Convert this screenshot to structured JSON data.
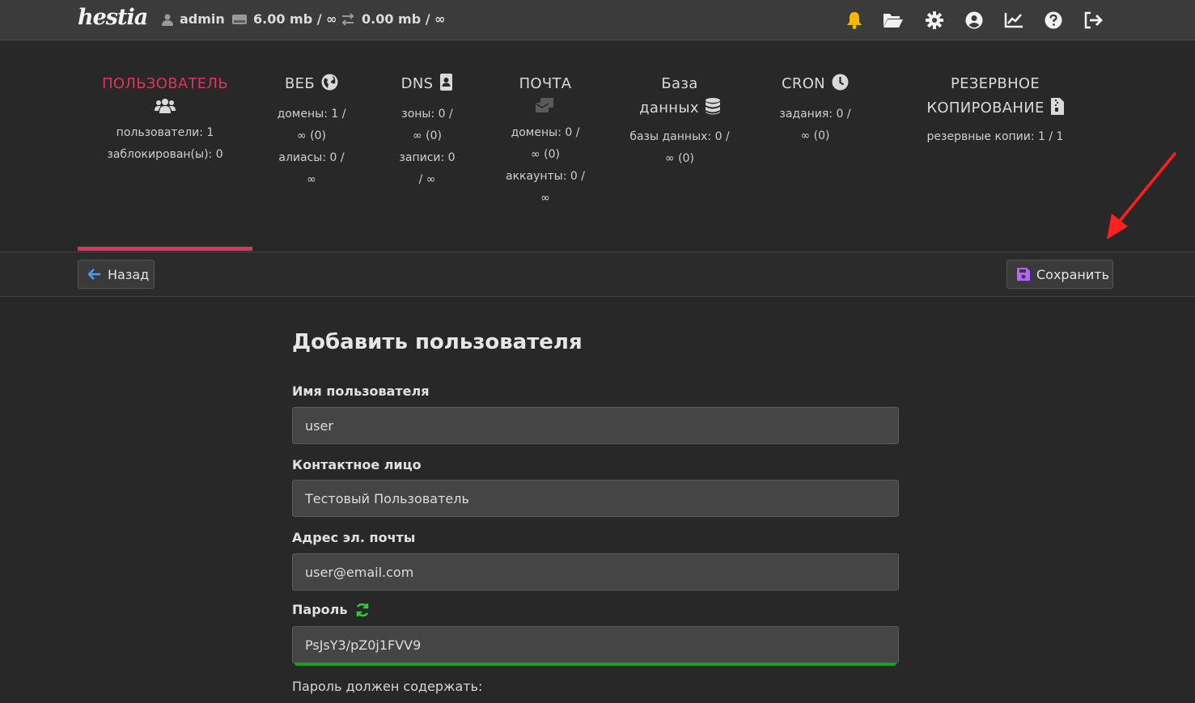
{
  "app": {
    "logo_text": "hestia"
  },
  "topbar": {
    "user": "admin",
    "disk": "6.00 mb / ∞",
    "bandwidth": "0.00 mb / ∞",
    "icons": [
      "bell-icon",
      "folder-open-icon",
      "gear-icon",
      "user-circle-icon",
      "chart-line-icon",
      "question-circle-icon",
      "logout-icon"
    ],
    "bell_color": "#f5b800"
  },
  "tabs": [
    {
      "title": "ПОЛЬЗОВАТЕЛЬ",
      "icon": "users-icon",
      "active": true,
      "stats": [
        "пользователи: 1",
        "заблокирован(ы): 0"
      ]
    },
    {
      "title": "ВЕБ",
      "icon": "globe-icon",
      "stats": [
        "домены: 1 /",
        "∞ (0)",
        "алиасы: 0 /",
        "∞"
      ]
    },
    {
      "title": "DNS",
      "icon": "address-book-icon",
      "stats": [
        "зоны: 0 /",
        "∞ (0)",
        "записи: 0",
        "/ ∞"
      ]
    },
    {
      "title": "ПОЧТА",
      "icon": "mail-bulk-icon",
      "stats": [
        "домены: 0 /",
        "∞ (0)",
        "аккаунты: 0 /",
        "∞"
      ]
    },
    {
      "title_line1": "База",
      "title_line2": "данных",
      "icon": "database-icon",
      "stats": [
        "базы данных: 0 /",
        "∞ (0)"
      ]
    },
    {
      "title": "CRON",
      "icon": "clock-icon",
      "stats": [
        "задания: 0 /",
        "∞ (0)"
      ]
    },
    {
      "title_line1": "РЕЗЕРВНОЕ",
      "title_line2": "КОПИРОВАНИЕ",
      "icon": "file-archive-icon",
      "stats": [
        "резервные копии: 1 / 1"
      ]
    }
  ],
  "toolbar": {
    "back_label": "Назад",
    "save_label": "Сохранить"
  },
  "form": {
    "title": "Добавить пользователя",
    "username_label": "Имя пользователя",
    "username_value": "user",
    "contact_label": "Контактное лицо",
    "contact_value": "Тестовый Пользователь",
    "email_label": "Адрес эл. почты",
    "email_value": "user@email.com",
    "password_label": "Пароль",
    "password_value": "PsJsY3/pZ0j1FVV9",
    "password_note": "Пароль должен содержать:"
  },
  "colors": {
    "accent": "#d8365f",
    "save_icon": "#b266ff",
    "back_icon": "#4a9eff",
    "refresh_icon": "#2ecc40",
    "strength_bar": "#1e9e1e",
    "annotation_arrow": "#ff2020"
  }
}
